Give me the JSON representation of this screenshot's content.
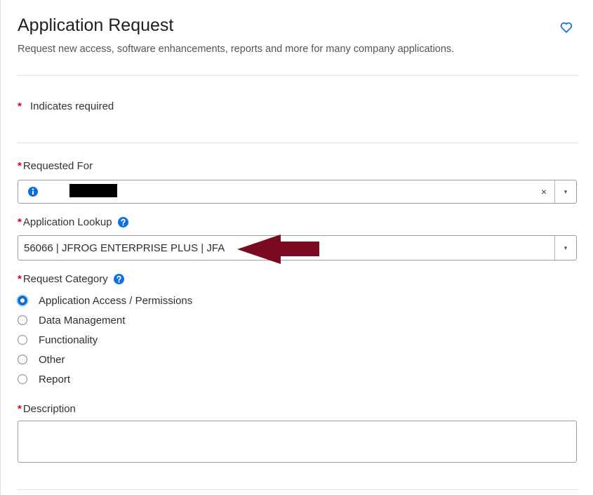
{
  "header": {
    "title": "Application Request",
    "subtitle": "Request new access, software enhancements, reports and more for many company applications.",
    "favorite_icon": "heart-outline-icon"
  },
  "required_note": {
    "star": "*",
    "text": "Indicates required"
  },
  "requested_for": {
    "star": "*",
    "label": "Requested For",
    "value": "",
    "clear": "×",
    "caret": "▾"
  },
  "application_lookup": {
    "star": "*",
    "label": "Application Lookup",
    "value": "56066 | JFROG ENTERPRISE PLUS | JFA",
    "caret": "▾"
  },
  "request_category": {
    "star": "*",
    "label": "Request Category",
    "options": [
      {
        "label": "Application Access / Permissions",
        "selected": true
      },
      {
        "label": "Data Management",
        "selected": false
      },
      {
        "label": "Functionality",
        "selected": false
      },
      {
        "label": "Other",
        "selected": false
      },
      {
        "label": "Report",
        "selected": false
      }
    ]
  },
  "description": {
    "star": "*",
    "label": "Description",
    "value": ""
  },
  "colors": {
    "required_star": "#d9001b",
    "accent_blue": "#0e6fe0",
    "annotation_arrow": "#7a0a1f"
  }
}
